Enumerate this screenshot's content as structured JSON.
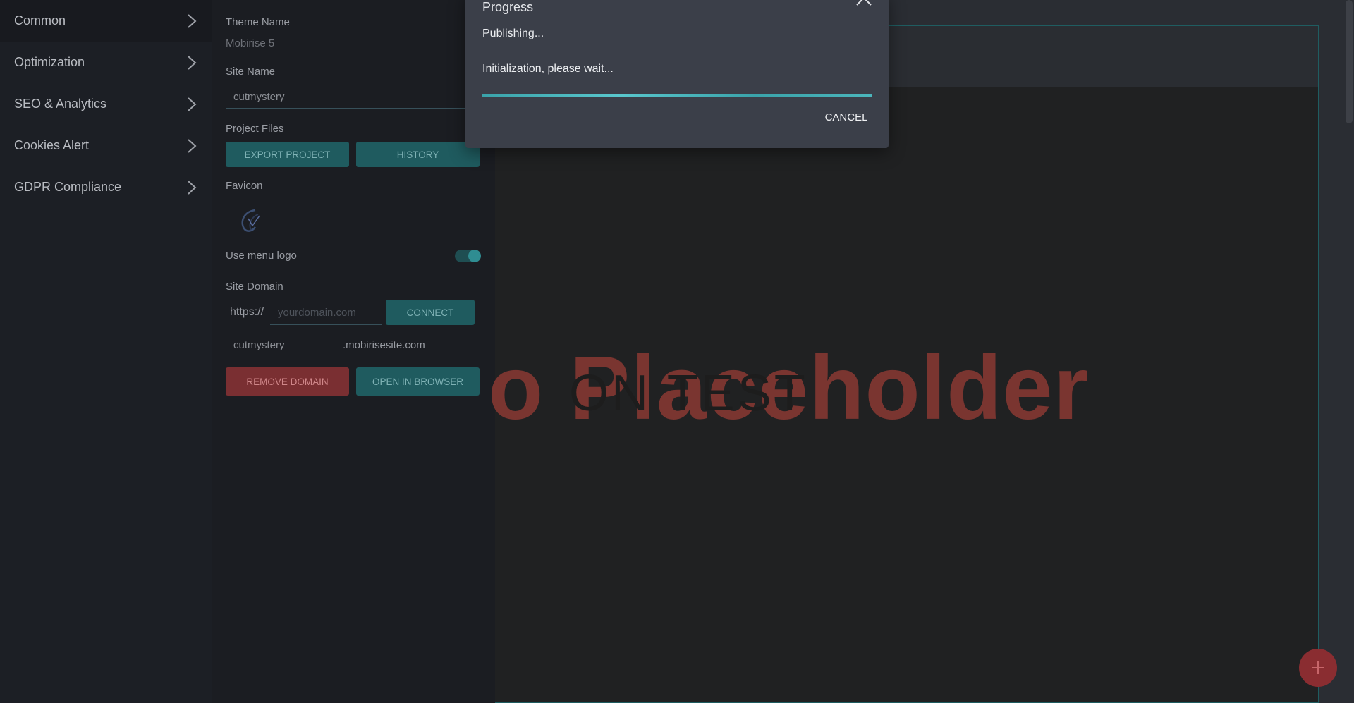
{
  "sidebar": {
    "items": [
      {
        "label": "Common"
      },
      {
        "label": "Optimization"
      },
      {
        "label": "SEO & Analytics"
      },
      {
        "label": "Cookies Alert"
      },
      {
        "label": "GDPR Compliance"
      }
    ]
  },
  "settings": {
    "theme_name_label": "Theme Name",
    "theme_name_value": "Mobirise 5",
    "site_name_label": "Site Name",
    "site_name_value": "cutmystery",
    "project_files_label": "Project Files",
    "export_project_label": "EXPORT PROJECT",
    "history_label": "HISTORY",
    "favicon_label": "Favicon",
    "use_menu_logo_label": "Use menu logo",
    "use_menu_logo_on": true,
    "site_domain_label": "Site Domain",
    "protocol_prefix": "https://",
    "domain_placeholder": "yourdomain.com",
    "connect_label": "CONNECT",
    "subdomain_value": "cutmystery",
    "subdomain_suffix": ".mobirisesite.com",
    "remove_domain_label": "REMOVE DOMAIN",
    "open_in_browser_label": "OPEN IN BROWSER"
  },
  "preview": {
    "placeholder_text": "o Placeholder",
    "overlay_text": "ON TEST"
  },
  "dialog": {
    "title": "Progress",
    "status": "Publishing...",
    "message": "Initialization, please wait...",
    "progress": 1.0,
    "cancel_label": "CANCEL"
  },
  "colors": {
    "accent_teal": "#1f5b5f",
    "danger_red": "#7a2f32",
    "progress_teal": "#3aa3aa"
  },
  "icons": {
    "sidebar_chevron": "chevron-right-icon",
    "dialog_close": "chevron-up-icon",
    "fab": "plus-icon"
  }
}
